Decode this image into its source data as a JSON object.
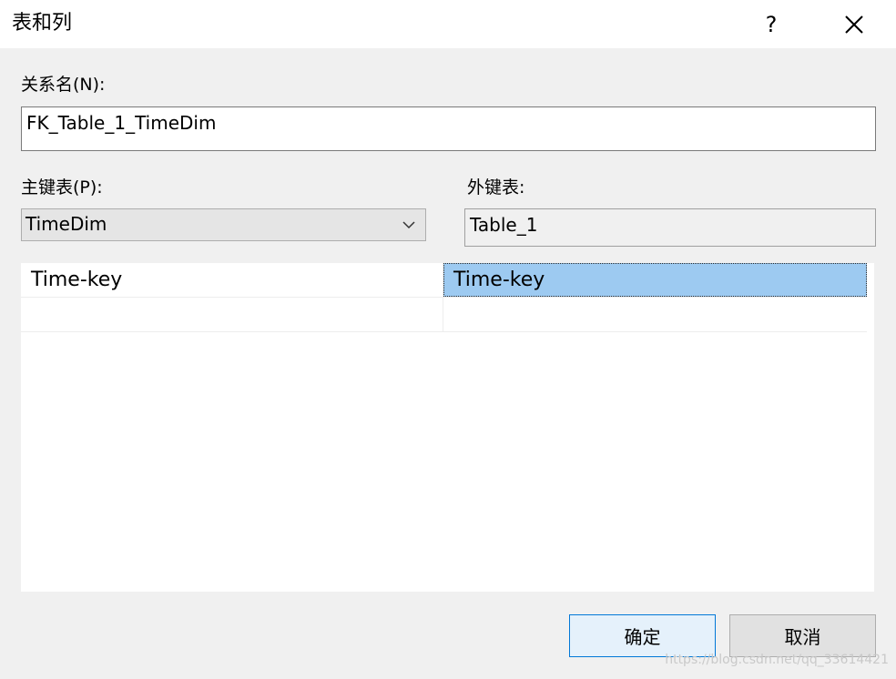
{
  "window": {
    "title": "表和列",
    "help_label": "?"
  },
  "relation": {
    "label": "关系名(N):",
    "value": "FK_Table_1_TimeDim"
  },
  "primary_table": {
    "label": "主键表(P):",
    "selected": "TimeDim"
  },
  "foreign_table": {
    "label": "外键表:",
    "value": "Table_1"
  },
  "columns_grid": {
    "rows": [
      {
        "primary": "Time-key",
        "foreign": "Time-key"
      },
      {
        "primary": "",
        "foreign": ""
      }
    ]
  },
  "buttons": {
    "ok": "确定",
    "cancel": "取消"
  },
  "watermark": "https://blog.csdn.net/qq_33614421",
  "colors": {
    "selection": "#9dcaf1",
    "ok_border": "#0078d7"
  },
  "icons": {
    "close": "close-icon",
    "dropdown": "chevron-down-icon"
  }
}
